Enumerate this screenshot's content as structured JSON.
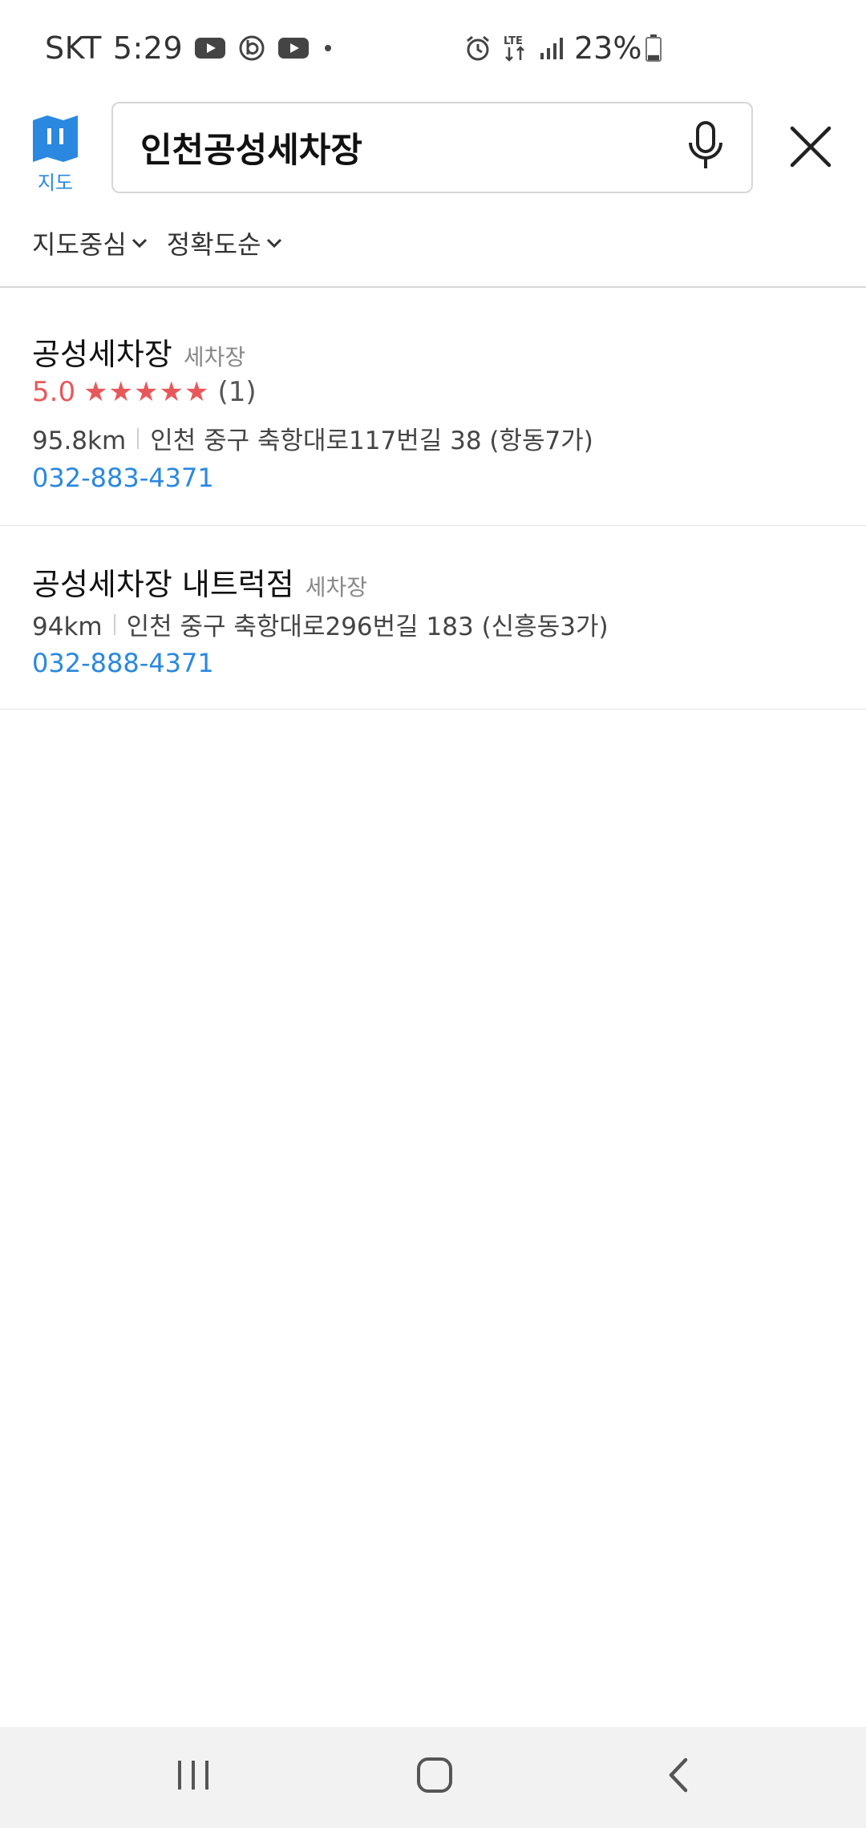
{
  "status_bar": {
    "carrier": "SKT",
    "time": "5:29",
    "left_icons": [
      "youtube-icon",
      "b-app-icon",
      "youtube-icon",
      "dot-icon"
    ],
    "right_icons": [
      "alarm-icon",
      "lte-icon",
      "signal-icon"
    ],
    "network_label": "LTE",
    "battery_percent": "23%",
    "battery_level": 0.23
  },
  "header": {
    "map_label": "지도",
    "search_value": "인천공성세차장",
    "accent_color": "#2a88e0"
  },
  "filters": [
    {
      "label": "지도중심"
    },
    {
      "label": "정확도순"
    }
  ],
  "results": [
    {
      "name": "공성세차장",
      "category": "세차장",
      "rating": "5.0",
      "stars": "★★★★★",
      "stars_value": 5,
      "review_count": "(1)",
      "distance": "95.8km",
      "address": "인천 중구 축항대로117번길 38 (항동7가)",
      "phone": "032-883-4371"
    },
    {
      "name": "공성세차장 내트럭점",
      "category": "세차장",
      "distance": "94km",
      "address": "인천 중구 축항대로296번길 183 (신흥동3가)",
      "phone": "032-888-4371"
    }
  ],
  "nav_bar": {
    "buttons": [
      "recent-apps-icon",
      "home-icon",
      "back-icon"
    ]
  },
  "colors": {
    "rating": "#e8585a",
    "link": "#2a88e0",
    "text": "#222222",
    "nav_background": "#f2f2f2"
  }
}
